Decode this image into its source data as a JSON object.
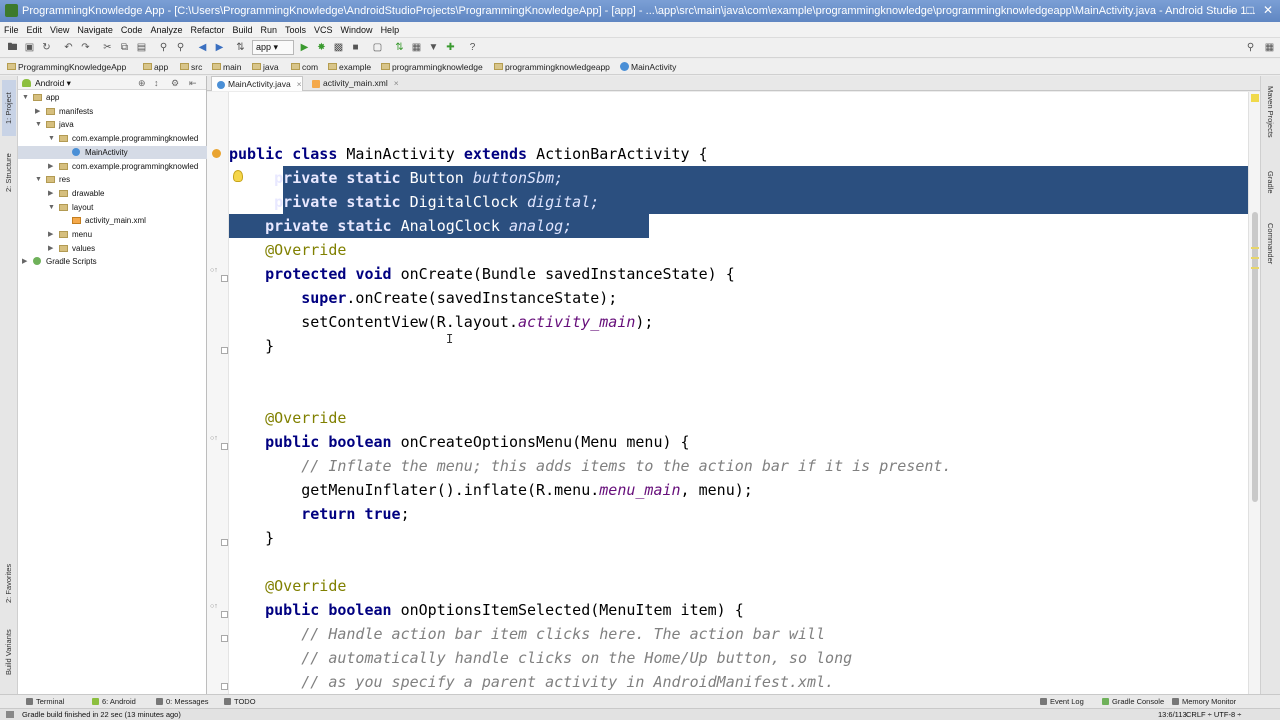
{
  "window": {
    "title": "ProgrammingKnowledge App - [C:\\Users\\ProgrammingKnowledge\\AndroidStudioProjects\\ProgrammingKnowledgeApp] - [app] - ...\\app\\src\\main\\java\\com\\example\\programmingknowledge\\programmingknowledgeapp\\MainActivity.java - Android Studio 1..."
  },
  "menu": [
    "File",
    "Edit",
    "View",
    "Navigate",
    "Code",
    "Analyze",
    "Refactor",
    "Build",
    "Run",
    "Tools",
    "VCS",
    "Window",
    "Help"
  ],
  "toolbar": {
    "run_config": "app"
  },
  "breadcrumb": [
    "ProgrammingKnowledgeApp",
    "app",
    "src",
    "main",
    "java",
    "com",
    "example",
    "programmingknowledge",
    "programmingknowledgeapp",
    "MainActivity"
  ],
  "sidebar_tabs": {
    "project": "1: Project",
    "structure": "2: Structure",
    "favorites": "2: Favorites",
    "build_variants": "Build Variants"
  },
  "right_tabs": {
    "maven": "Maven Projects",
    "gradle": "Gradle",
    "commander": "Commander"
  },
  "project_panel": {
    "view_selector": "Android",
    "tree": [
      {
        "label": "app",
        "type": "folder",
        "depth": 0,
        "expanded": true
      },
      {
        "label": "manifests",
        "type": "folder",
        "depth": 1,
        "expanded": false
      },
      {
        "label": "java",
        "type": "folder",
        "depth": 1,
        "expanded": true
      },
      {
        "label": "com.example.programmingknowled",
        "type": "folder",
        "depth": 2,
        "expanded": true
      },
      {
        "label": "MainActivity",
        "type": "class",
        "depth": 3,
        "selected": true
      },
      {
        "label": "com.example.programmingknowled",
        "type": "folder",
        "depth": 2,
        "expanded": false
      },
      {
        "label": "res",
        "type": "folder",
        "depth": 1,
        "expanded": true
      },
      {
        "label": "drawable",
        "type": "folder",
        "depth": 2,
        "expanded": false
      },
      {
        "label": "layout",
        "type": "folder",
        "depth": 2,
        "expanded": true
      },
      {
        "label": "activity_main.xml",
        "type": "xml",
        "depth": 3
      },
      {
        "label": "menu",
        "type": "folder",
        "depth": 2,
        "expanded": false
      },
      {
        "label": "values",
        "type": "folder",
        "depth": 2,
        "expanded": false
      },
      {
        "label": "Gradle Scripts",
        "type": "gradle",
        "depth": 0,
        "expanded": false
      }
    ]
  },
  "editor_tabs": [
    {
      "label": "MainActivity.java",
      "active": true,
      "kind": "java"
    },
    {
      "label": "activity_main.xml",
      "active": false,
      "kind": "xml"
    }
  ],
  "code": {
    "class_decl": [
      "public",
      "class",
      "MainActivity",
      "extends",
      "ActionBarActivity",
      "{"
    ],
    "field1": [
      "private",
      "static",
      "Button",
      "buttonSbm;"
    ],
    "field2": [
      "private",
      "static",
      "DigitalClock",
      "digital;"
    ],
    "field3": [
      "private",
      "static",
      "AnalogClock",
      "analog;"
    ],
    "override": "@Override",
    "oncreate_sig": [
      "protected",
      "void",
      "onCreate(Bundle savedInstanceState) {"
    ],
    "super_call": [
      "super",
      ".onCreate(savedInstanceState);"
    ],
    "setcontent": [
      "setContentView(R.layout.",
      "activity_main",
      ");"
    ],
    "close_brace": "}",
    "menu_sig": [
      "public",
      "boolean",
      "onCreateOptionsMenu(Menu menu) {"
    ],
    "menu_comment": "// Inflate the menu; this adds items to the action bar if it is present.",
    "inflate": [
      "getMenuInflater().inflate(R.menu.",
      "menu_main",
      ", menu);"
    ],
    "return_true": [
      "return",
      "true",
      ";"
    ],
    "item_sig": [
      "public",
      "boolean",
      "onOptionsItemSelected(MenuItem item) {"
    ],
    "item_comment1": "// Handle action bar item clicks here. The action bar will",
    "item_comment2": "// automatically handle clicks on the Home/Up button, so long",
    "item_comment3": "// as you specify a parent activity in AndroidManifest.xml."
  },
  "bottom_tabs": {
    "terminal": "Terminal",
    "android": "6: Android",
    "messages": "0: Messages",
    "todo": "TODO",
    "event_log": "Event Log",
    "gradle_console": "Gradle Console",
    "memory_monitor": "Memory Monitor"
  },
  "status": {
    "message": "Gradle build finished in 22 sec (13 minutes ago)",
    "position": "13:6/113",
    "encoding": "CRLF ÷  UTF-8 ÷"
  }
}
